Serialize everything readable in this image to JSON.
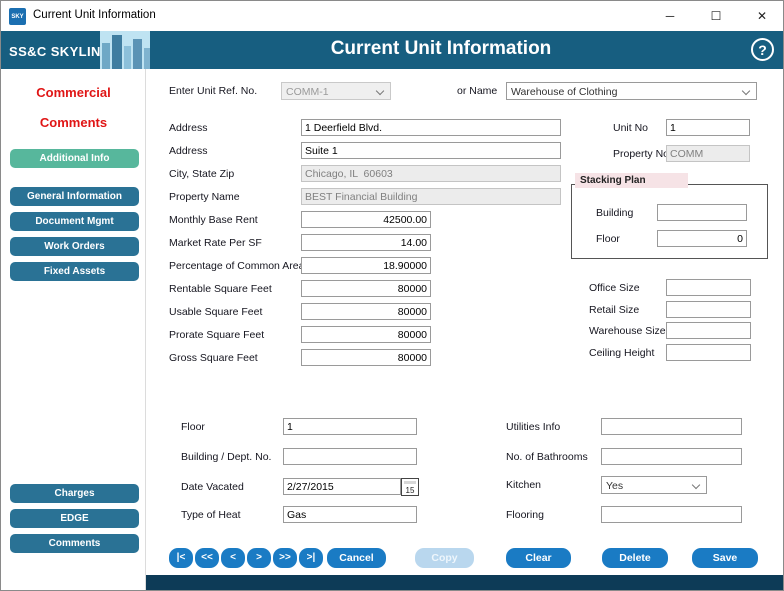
{
  "window": {
    "icon_text": "SKY",
    "title": "Current Unit Information",
    "controls": {
      "minimize": "─",
      "maximize": "☐",
      "close": "✕"
    }
  },
  "header": {
    "brand": "SS&C SKYLINE",
    "brand_mark": "®",
    "title": "Current Unit Information",
    "help": "?"
  },
  "sidebar": {
    "heading_line1": "Commercial",
    "heading_line2": "Comments",
    "nav": [
      {
        "label": "Additional Info"
      },
      {
        "label": "General Information"
      },
      {
        "label": "Document Mgmt"
      },
      {
        "label": "Work Orders"
      },
      {
        "label": "Fixed Assets"
      }
    ],
    "bottom": [
      {
        "label": "Charges"
      },
      {
        "label": "EDGE"
      },
      {
        "label": "Comments"
      }
    ]
  },
  "form": {
    "unit_ref": {
      "label": "Enter Unit Ref. No.",
      "value": "COMM-1"
    },
    "name": {
      "label": "or Name",
      "value": "Warehouse of Clothing"
    },
    "address1": {
      "label": "Address",
      "value": "1 Deerfield Blvd."
    },
    "address2": {
      "label": "Address",
      "value": "Suite 1"
    },
    "city_state_zip": {
      "label": "City, State Zip",
      "value": "Chicago, IL  60603"
    },
    "property_name": {
      "label": "Property Name",
      "value": "BEST Financial Building"
    },
    "monthly_base_rent": {
      "label": "Monthly Base Rent",
      "value": "42500.00"
    },
    "market_rate_per_sf": {
      "label": "Market Rate Per SF",
      "value": "14.00"
    },
    "pct_common_area": {
      "label": "Percentage of Common Area",
      "value": "18.90000"
    },
    "rentable_sqft": {
      "label": "Rentable Square Feet",
      "value": "80000"
    },
    "usable_sqft": {
      "label": "Usable Square Feet",
      "value": "80000"
    },
    "prorate_sqft": {
      "label": "Prorate Square Feet",
      "value": "80000"
    },
    "gross_sqft": {
      "label": "Gross Square Feet",
      "value": "80000"
    },
    "unit_no": {
      "label": "Unit No",
      "value": "1"
    },
    "property_no": {
      "label": "Property No.",
      "value": "COMM"
    },
    "stacking_plan": {
      "title": "Stacking Plan",
      "building": {
        "label": "Building",
        "value": ""
      },
      "floor": {
        "label": "Floor",
        "value": "0"
      }
    },
    "office_size": {
      "label": "Office Size",
      "value": ""
    },
    "retail_size": {
      "label": "Retail Size",
      "value": ""
    },
    "warehouse_size": {
      "label": "Warehouse Size",
      "value": ""
    },
    "ceiling_height": {
      "label": "Ceiling Height",
      "value": ""
    },
    "floor": {
      "label": "Floor",
      "value": "1"
    },
    "building_dept_no": {
      "label": "Building / Dept. No.",
      "value": ""
    },
    "date_vacated": {
      "label": "Date Vacated",
      "value": "2/27/2015",
      "icon_day": "15"
    },
    "type_of_heat": {
      "label": "Type of Heat",
      "value": "Gas"
    },
    "utilities_info": {
      "label": "Utilities Info",
      "value": ""
    },
    "no_of_bathrooms": {
      "label": "No. of Bathrooms",
      "value": ""
    },
    "kitchen": {
      "label": "Kitchen",
      "value": "Yes"
    },
    "flooring": {
      "label": "Flooring",
      "value": ""
    }
  },
  "actions": {
    "nav": [
      "|<",
      "<<",
      "<",
      ">",
      ">>",
      ">|"
    ],
    "cancel": "Cancel",
    "copy": "Copy",
    "clear": "Clear",
    "delete": "Delete",
    "save": "Save"
  },
  "colors": {
    "header_blue": "#175E80",
    "bottom_bar_navy": "#0D3B57",
    "sidebar_teal": "#2A7295",
    "active_green": "#57B79C",
    "action_blue": "#1A7BC4",
    "disabled_blue": "#B9D7EE",
    "heading_red": "#E01616",
    "stacking_title_pink": "#F6E3E6"
  }
}
